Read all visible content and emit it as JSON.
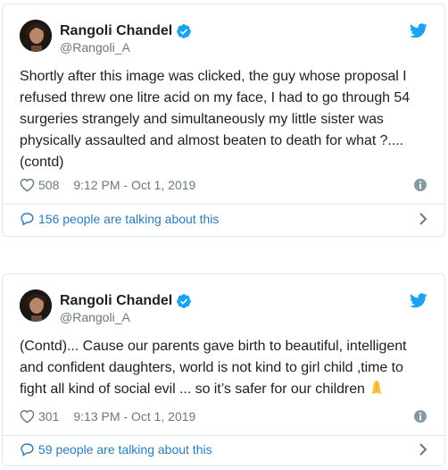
{
  "tweets": [
    {
      "author": {
        "name": "Rangoli Chandel",
        "handle": "@Rangoli_A",
        "verified": true
      },
      "text": "Shortly after this image was clicked, the guy whose proposal I refused threw one litre acid on my face, I had to go through 54 surgeries strangely and simultaneously my little sister was physically assaulted and almost beaten to death for what ?.... (contd)",
      "likes": "508",
      "timestamp": "9:12 PM - Oct 1, 2019",
      "discussion": "156 people are talking about this"
    },
    {
      "author": {
        "name": "Rangoli Chandel",
        "handle": "@Rangoli_A",
        "verified": true
      },
      "text": "(Contd)... Cause our parents gave birth to beautiful, intelligent and confident daughters, world is not kind to girl child ,time to fight all kind of social evil ... so it’s safer for our children",
      "emoji": "folded-hands",
      "likes": "301",
      "timestamp": "9:13 PM - Oct 1, 2019",
      "discussion": "59 people are talking about this"
    }
  ],
  "colors": {
    "text": "#1c2022",
    "secondary": "#697882",
    "link": "#2b7bb9",
    "verified": "#1da1f2",
    "twitter_brand": "#1da1f2",
    "border": "#e1e8ed"
  },
  "icons": {
    "brand": "twitter-bird-icon",
    "verified": "verified-badge-icon",
    "like": "heart-icon",
    "info": "info-icon",
    "discussion": "speech-bubble-icon",
    "more": "chevron-right-icon"
  }
}
